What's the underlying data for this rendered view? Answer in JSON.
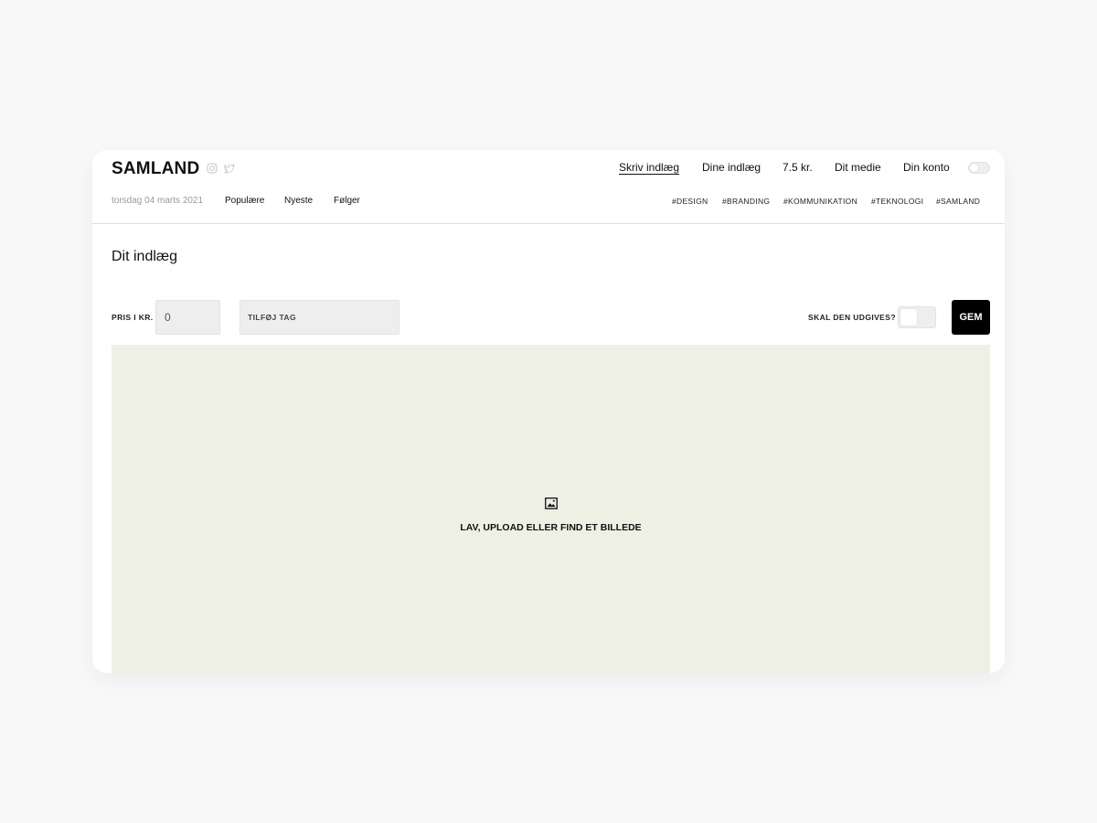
{
  "header": {
    "brand": "SAMLAND",
    "social": [
      "instagram-icon",
      "twitter-icon"
    ],
    "nav": {
      "write": "Skriv indlæg",
      "my_posts": "Dine indlæg",
      "balance": "7.5 kr.",
      "my_media": "Dit medie",
      "account": "Din konto"
    },
    "date": "torsdag 04 marts 2021",
    "filters": {
      "popular": "Populære",
      "newest": "Nyeste",
      "following": "Følger"
    },
    "tags": [
      "#DESIGN",
      "#BRANDING",
      "#KOMMUNIKATION",
      "#TEKNOLOGI",
      "#SAMLAND"
    ]
  },
  "editor": {
    "title": "Dit indlæg",
    "price_label": "PRIS I KR.",
    "price_value": "0",
    "tag_placeholder": "TILFØJ TAG",
    "publish_label": "SKAL DEN UDGIVES?",
    "publish_on": false,
    "save_label": "GEM",
    "image_prompt": "LAV, UPLOAD ELLER FIND ET BILLEDE",
    "image_icon": "image-icon"
  },
  "colors": {
    "image_area": "#eff0e4",
    "save_button": "#000000",
    "input_bg": "#eeeeee"
  }
}
